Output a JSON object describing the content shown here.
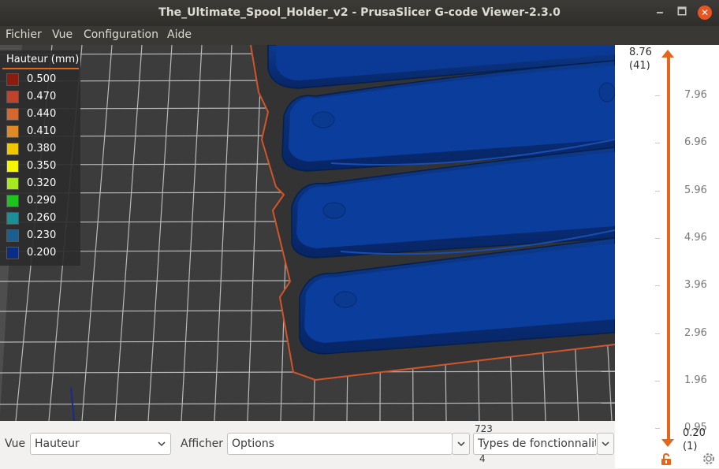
{
  "window": {
    "title": "The_Ultimate_Spool_Holder_v2 - PrusaSlicer G-code Viewer-2.3.0",
    "minimize_glyph": "🗕",
    "maximize_glyph": "🗖",
    "close_glyph": "✕"
  },
  "menu": [
    "Fichier",
    "Vue",
    "Configuration",
    "Aide"
  ],
  "legend": {
    "title": "Hauteur (mm)",
    "items": [
      {
        "value": "0.500",
        "color": "#8c1c10"
      },
      {
        "value": "0.470",
        "color": "#c0442b"
      },
      {
        "value": "0.440",
        "color": "#d4682f"
      },
      {
        "value": "0.410",
        "color": "#e08a25"
      },
      {
        "value": "0.380",
        "color": "#f0c800"
      },
      {
        "value": "0.350",
        "color": "#f5f500"
      },
      {
        "value": "0.320",
        "color": "#a8e81e"
      },
      {
        "value": "0.290",
        "color": "#1dc41d"
      },
      {
        "value": "0.260",
        "color": "#1a8f96"
      },
      {
        "value": "0.230",
        "color": "#1a5f8f"
      },
      {
        "value": "0.200",
        "color": "#0a2e86"
      }
    ]
  },
  "layer_slider": {
    "top_value": "8.76",
    "top_layer": "(41)",
    "bottom_value": "0.20",
    "bottom_layer": "(1)",
    "ticks": [
      "7.96",
      "6.96",
      "5.96",
      "4.96",
      "3.96",
      "2.96",
      "1.96",
      "0.95"
    ],
    "accent": "#e3661c"
  },
  "bottom": {
    "view_label": "Vue",
    "view_value": "Hauteur",
    "show_label": "Afficher",
    "options_value": "Options",
    "move_number_top": "723",
    "move_number_bottom": "4",
    "feature_types_value": "Types de fonctionnalit"
  }
}
